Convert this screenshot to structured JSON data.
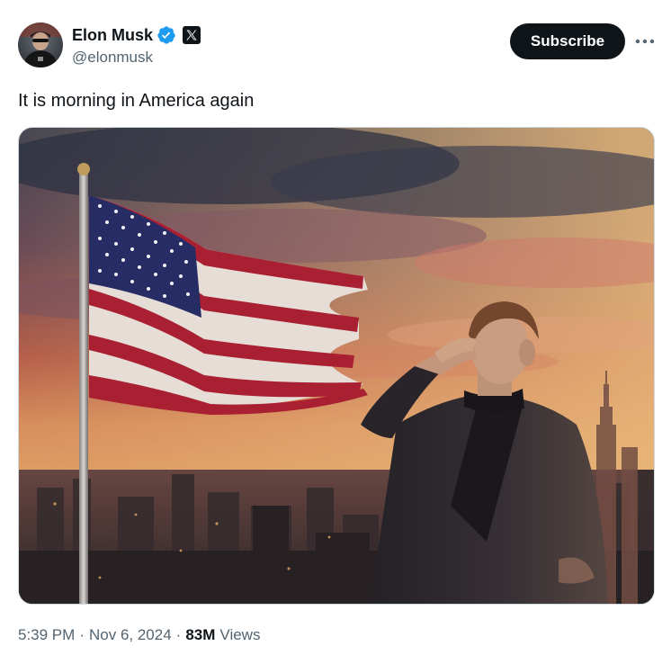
{
  "author": {
    "display_name": "Elon Musk",
    "handle": "@elonmusk",
    "verified_color": "#1d9bf0",
    "affiliation_badge": "x-logo-icon"
  },
  "actions": {
    "subscribe_label": "Subscribe",
    "more_icon": "more-horizontal-icon"
  },
  "tweet": {
    "text": "It is morning in America again",
    "media_description_icon": "photo"
  },
  "meta": {
    "time": "5:39 PM",
    "date": "Nov 6, 2024",
    "separator": "·",
    "views_count": "83M",
    "views_label": "Views"
  },
  "colors": {
    "text_primary": "#0f1419",
    "text_secondary": "#536471",
    "button_dark": "#0f1419",
    "border": "#cfd9de"
  }
}
